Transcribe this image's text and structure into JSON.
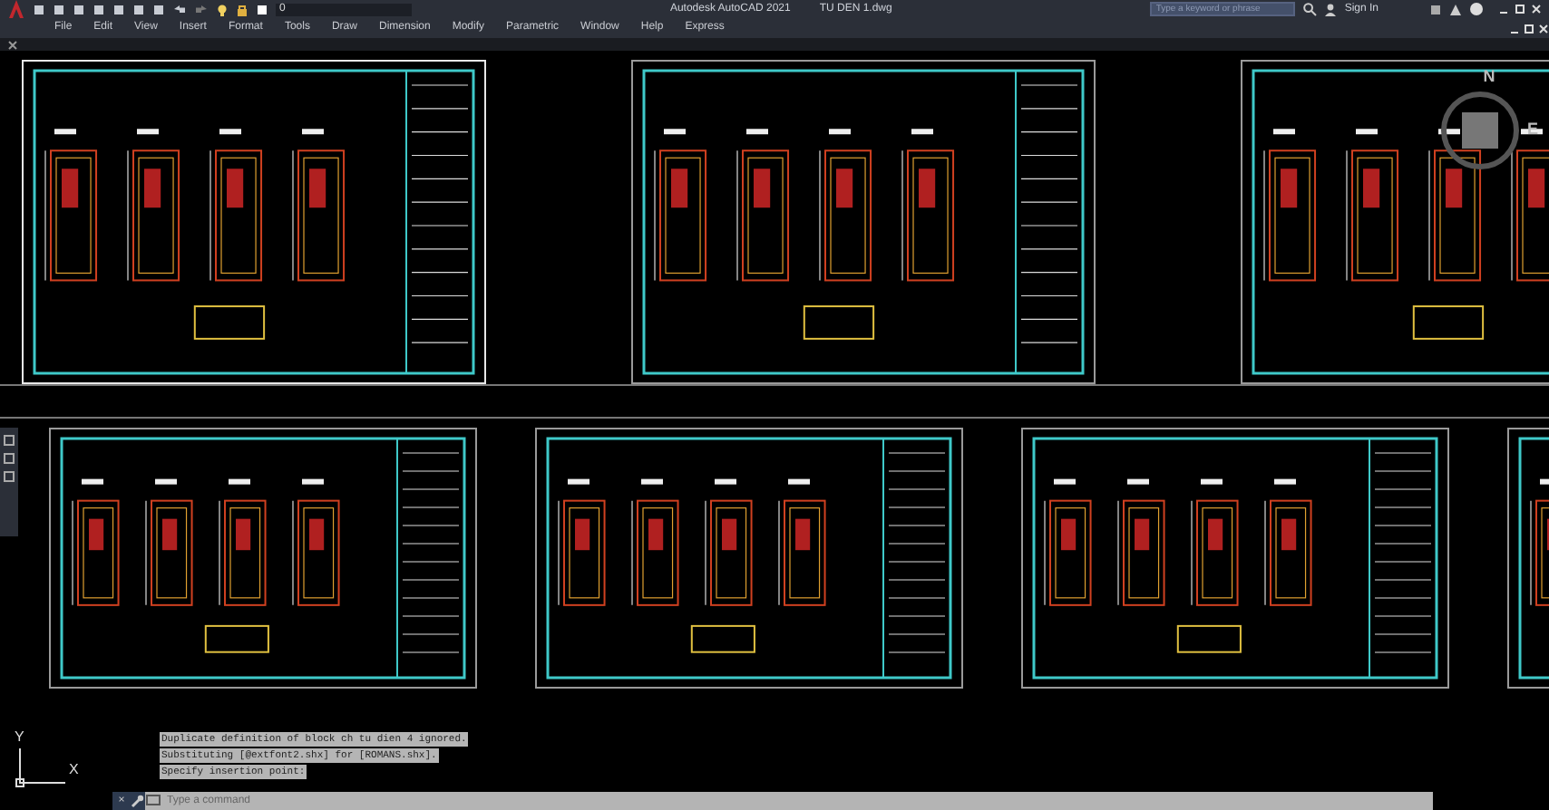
{
  "title_bar": {
    "app": "Autodesk AutoCAD 2021",
    "file": "TU DEN 1.dwg",
    "layer": "0",
    "search": {
      "placeholder": "Type a keyword or phrase"
    },
    "sign_in": "Sign In"
  },
  "menu": [
    "File",
    "Edit",
    "View",
    "Insert",
    "Format",
    "Tools",
    "Draw",
    "Dimension",
    "Modify",
    "Parametric",
    "Window",
    "Help",
    "Express"
  ],
  "viewports": [
    {
      "sheets": [
        {
          "selected": true
        },
        {
          "selected": false
        },
        {
          "selected": false
        }
      ]
    },
    {
      "sheets": [
        {
          "selected": false
        },
        {
          "selected": false
        },
        {
          "selected": false
        },
        {
          "selected": false
        }
      ]
    }
  ],
  "view_cube": {
    "north": "N",
    "east": "E"
  },
  "ucs": {
    "y": "Y",
    "x": "X"
  },
  "command_history": [
    "Duplicate definition of block ch tu dien 4  ignored.",
    "Substituting [@extfont2.shx] for [ROMANS.shx].",
    "Specify insertion point:"
  ],
  "command_line": {
    "close": "×",
    "placeholder": "Type a command"
  }
}
